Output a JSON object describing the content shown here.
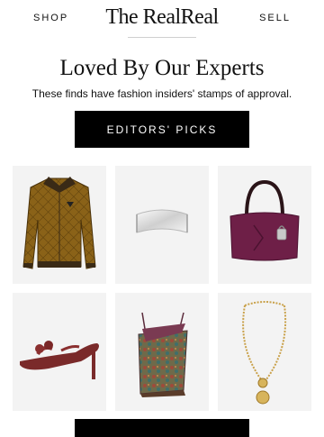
{
  "nav": {
    "shop_label": "SHOP",
    "brand": "The RealReal",
    "sell_label": "SELL"
  },
  "hero": {
    "headline": "Loved By Our Experts",
    "subhead": "These finds have fashion insiders' stamps of approval.",
    "cta_label": "EDITORS' PICKS"
  },
  "products": [
    {
      "icon": "quilted-jacket-icon"
    },
    {
      "icon": "silver-cuff-bracelet-icon"
    },
    {
      "icon": "burgundy-handbag-icon"
    },
    {
      "icon": "strappy-sandal-icon"
    },
    {
      "icon": "printed-camisole-icon"
    },
    {
      "icon": "gold-coin-necklace-icon"
    }
  ],
  "colors": {
    "accent": "#000000",
    "tile_bg": "#f3f3f3"
  }
}
